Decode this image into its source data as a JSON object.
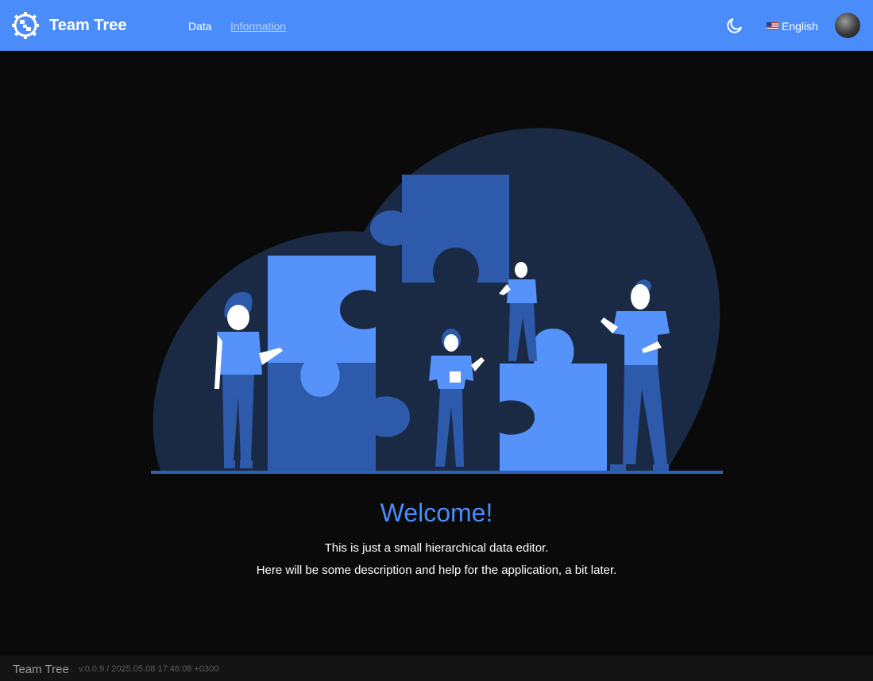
{
  "header": {
    "app_title": "Team Tree",
    "nav": [
      {
        "label": "Data"
      },
      {
        "label": "Information"
      }
    ],
    "language_label": "English",
    "icons": {
      "logo": "gear-tree-logo-icon",
      "theme": "moon-icon",
      "flag": "us-flag-icon",
      "avatar": "user-avatar"
    },
    "colors": {
      "background": "#4b8cfb",
      "active_link": "#ffffff",
      "inactive_link": "#bcd3fb"
    }
  },
  "main": {
    "welcome": "Welcome!",
    "line1": "This is just a small hierarchical data editor.",
    "line2": "Here will be some description and help for the application, a bit later."
  },
  "footer": {
    "title": "Team Tree",
    "version": "v.0.0.9 / 2025.05.08 17:46:08 +0300"
  }
}
